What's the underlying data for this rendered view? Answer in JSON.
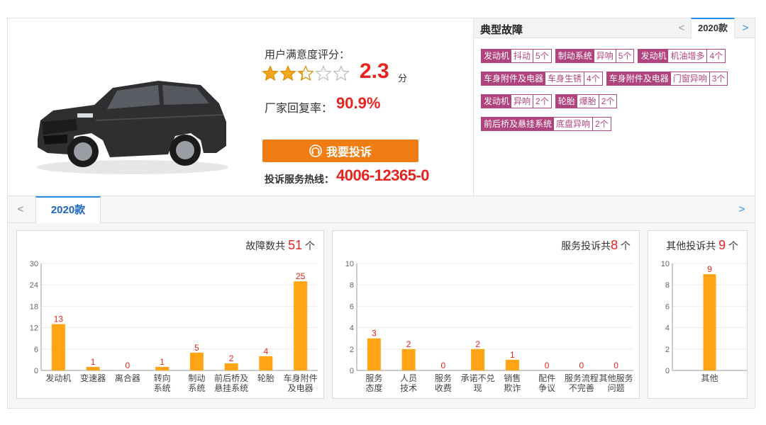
{
  "rating": {
    "title": "用户满意度评分：",
    "score": "2.3",
    "score_unit": "分",
    "stars": 2.3,
    "reply_label": "厂家回复率：",
    "reply_rate": "90.9%",
    "complain_button": "我要投诉",
    "hotline_label": "投诉服务热线：",
    "hotline_number": "4006-12365-0"
  },
  "faults": {
    "title": "典型故障",
    "prev": "<",
    "year": "2020款",
    "next": ">",
    "tags": [
      {
        "system": "发动机",
        "problem": "抖动",
        "count": "5个"
      },
      {
        "system": "制动系统",
        "problem": "异响",
        "count": "5个"
      },
      {
        "system": "发动机",
        "problem": "机油增多",
        "count": "4个"
      },
      {
        "system": "车身附件及电器",
        "problem": "车身生锈",
        "count": "4个"
      },
      {
        "system": "车身附件及电器",
        "problem": "门窗异响",
        "count": "3个"
      },
      {
        "system": "发动机",
        "problem": "异响",
        "count": "2个"
      },
      {
        "system": "轮胎",
        "problem": "爆胎",
        "count": "2个"
      },
      {
        "system": "前后桥及悬挂系统",
        "problem": "底盘异响",
        "count": "2个"
      }
    ]
  },
  "tabs": {
    "prev": "<",
    "active": "2020款",
    "next": ">"
  },
  "chart_titles": [
    {
      "prefix": "故障数共",
      "total": "51",
      "suffix": "个"
    },
    {
      "prefix": "服务投诉共",
      "total": "8",
      "suffix": "个"
    },
    {
      "prefix": "其他投诉共",
      "total": "9",
      "suffix": "个"
    }
  ],
  "colors": {
    "bar": "#ffa515",
    "value_label": "#e8231e",
    "tag": "#b0437d",
    "accent": "#2a8ee0",
    "button": "#f07d14"
  },
  "chart_data": [
    {
      "type": "bar",
      "categories": [
        "发动机",
        "变速器",
        "离合器",
        "转向\n系统",
        "制动\n系统",
        "前后桥及\n悬挂系统",
        "轮胎",
        "车身附件\n及电器"
      ],
      "values": [
        13,
        1,
        0,
        1,
        5,
        2,
        4,
        25
      ],
      "yticks": [
        0,
        6,
        12,
        18,
        24,
        30
      ],
      "ylim": [
        0,
        30
      ],
      "grid": true
    },
    {
      "type": "bar",
      "categories": [
        "服务\n态度",
        "人员\n技术",
        "服务\n收费",
        "承诺不兑\n现",
        "销售\n欺诈",
        "配件\n争议",
        "服务流程\n不完善",
        "其他服务\n问题"
      ],
      "values": [
        3,
        2,
        0,
        2,
        1,
        0,
        0,
        0
      ],
      "yticks": [
        0,
        2,
        4,
        6,
        8,
        10
      ],
      "ylim": [
        0,
        10
      ],
      "grid": true
    },
    {
      "type": "bar",
      "categories": [
        "其他"
      ],
      "values": [
        9
      ],
      "yticks": [
        0,
        2,
        4,
        6,
        8,
        10
      ],
      "ylim": [
        0,
        10
      ],
      "grid": true
    }
  ]
}
